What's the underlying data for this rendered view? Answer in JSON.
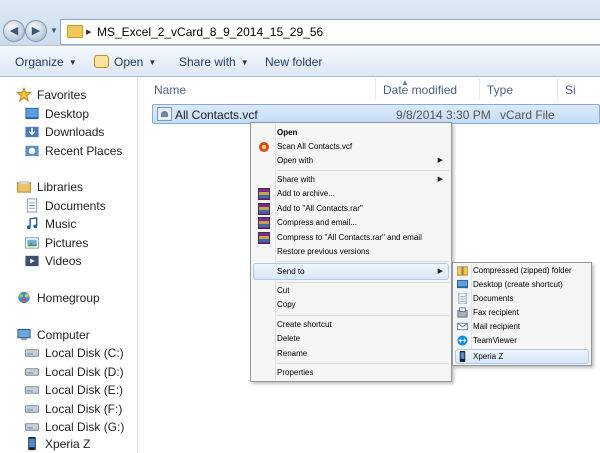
{
  "address": {
    "path": "MS_Excel_2_vCard_8_9_2014_15_29_56"
  },
  "toolbar": {
    "organize": "Organize",
    "open": "Open",
    "share_with": "Share with",
    "new_folder": "New folder"
  },
  "nav": {
    "favorites": "Favorites",
    "desktop": "Desktop",
    "downloads": "Downloads",
    "recent_places": "Recent Places",
    "libraries": "Libraries",
    "documents": "Documents",
    "music": "Music",
    "pictures": "Pictures",
    "videos": "Videos",
    "homegroup": "Homegroup",
    "computer": "Computer",
    "disk_c": "Local Disk (C:)",
    "disk_d": "Local Disk (D:)",
    "disk_e": "Local Disk (E:)",
    "disk_f": "Local Disk (F:)",
    "disk_g": "Local Disk (G:)",
    "xperia": "Xperia Z"
  },
  "columns": {
    "name": "Name",
    "date_modified": "Date modified",
    "type": "Type",
    "size": "Si"
  },
  "file": {
    "name": "All Contacts.vcf",
    "date": "9/8/2014 3:30 PM",
    "type": "vCard File"
  },
  "context_menu": {
    "open": "Open",
    "scan": "Scan All Contacts.vcf",
    "open_with": "Open with",
    "share_with": "Share with",
    "add_to_archive": "Add to archive...",
    "add_to_rar": "Add to \"All Contacts.rar\"",
    "compress_email": "Compress and email...",
    "compress_rar_email": "Compress to \"All Contacts.rar\" and email",
    "restore": "Restore previous versions",
    "send_to": "Send to",
    "cut": "Cut",
    "copy": "Copy",
    "create_shortcut": "Create shortcut",
    "delete": "Delete",
    "rename": "Rename",
    "properties": "Properties"
  },
  "send_to_menu": {
    "compressed": "Compressed (zipped) folder",
    "desktop": "Desktop (create shortcut)",
    "documents": "Documents",
    "fax": "Fax recipient",
    "mail": "Mail recipient",
    "teamviewer": "TeamViewer",
    "xperia": "Xperia Z"
  }
}
